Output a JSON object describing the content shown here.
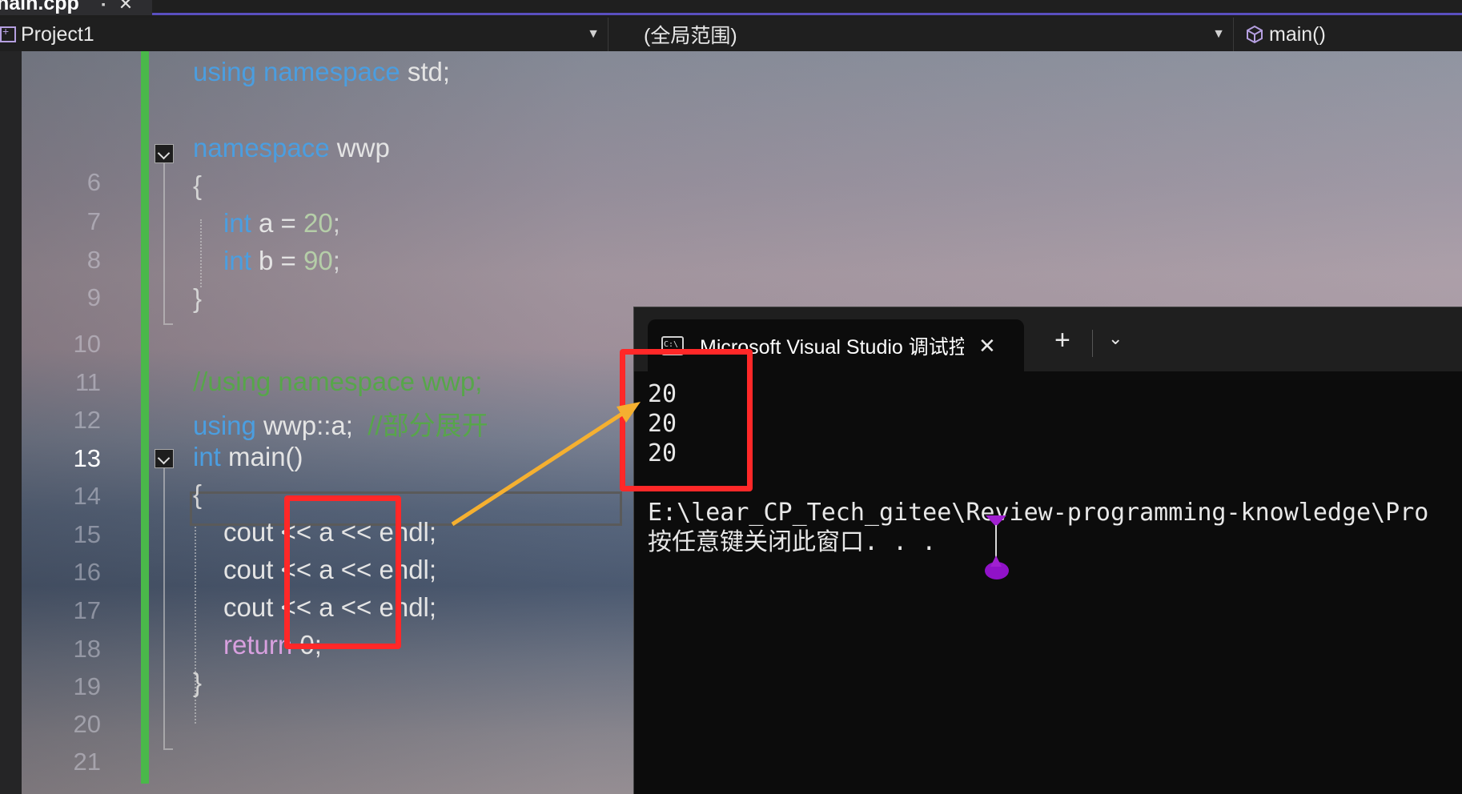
{
  "tab": {
    "title": "nain.cpp",
    "pin": "▪",
    "close": "✕"
  },
  "navbar": {
    "project": "Project1",
    "scope": "(全局范围)",
    "function": "main()"
  },
  "line_numbers": [
    "",
    "",
    "",
    "6",
    "7",
    "8",
    "9",
    "10",
    "11",
    "12",
    "13",
    "14",
    "15",
    "16",
    "17",
    "18",
    "19",
    "20",
    "21"
  ],
  "current_line": "13",
  "code": {
    "l1_kw": "using namespace",
    "l1_txt": " std;",
    "l3_kw": "namespace",
    "l3_txt": " wwp",
    "l4": "{",
    "l5_kw": "int",
    "l5_txt": " a = ",
    "l5_num": "20",
    "l5_end": ";",
    "l6_kw": "int",
    "l6_txt": " b = ",
    "l6_num": "90",
    "l6_end": ";",
    "l7": "}",
    "l9_com": "//using namespace wwp;",
    "l10_kw": "using",
    "l10_txt": " wwp::a;  ",
    "l10_com": "//部分展开",
    "l11_kw": "int",
    "l11_txt": " main()",
    "l12": "{",
    "l13": "cout << a << endl;",
    "l14": "cout << a << endl;",
    "l15": "cout << a << endl;",
    "l16_kw": "return",
    "l16_txt": " 0;",
    "l17": "}"
  },
  "terminal": {
    "title": "Microsoft Visual Studio 调试控制台",
    "close": "✕",
    "plus": "+",
    "dropdown": "⌄",
    "output": [
      "20",
      "20",
      "20",
      "",
      "E:\\lear_CP_Tech_gitee\\Review-programming-knowledge\\Pro",
      "按任意键关闭此窗口. . ."
    ]
  }
}
